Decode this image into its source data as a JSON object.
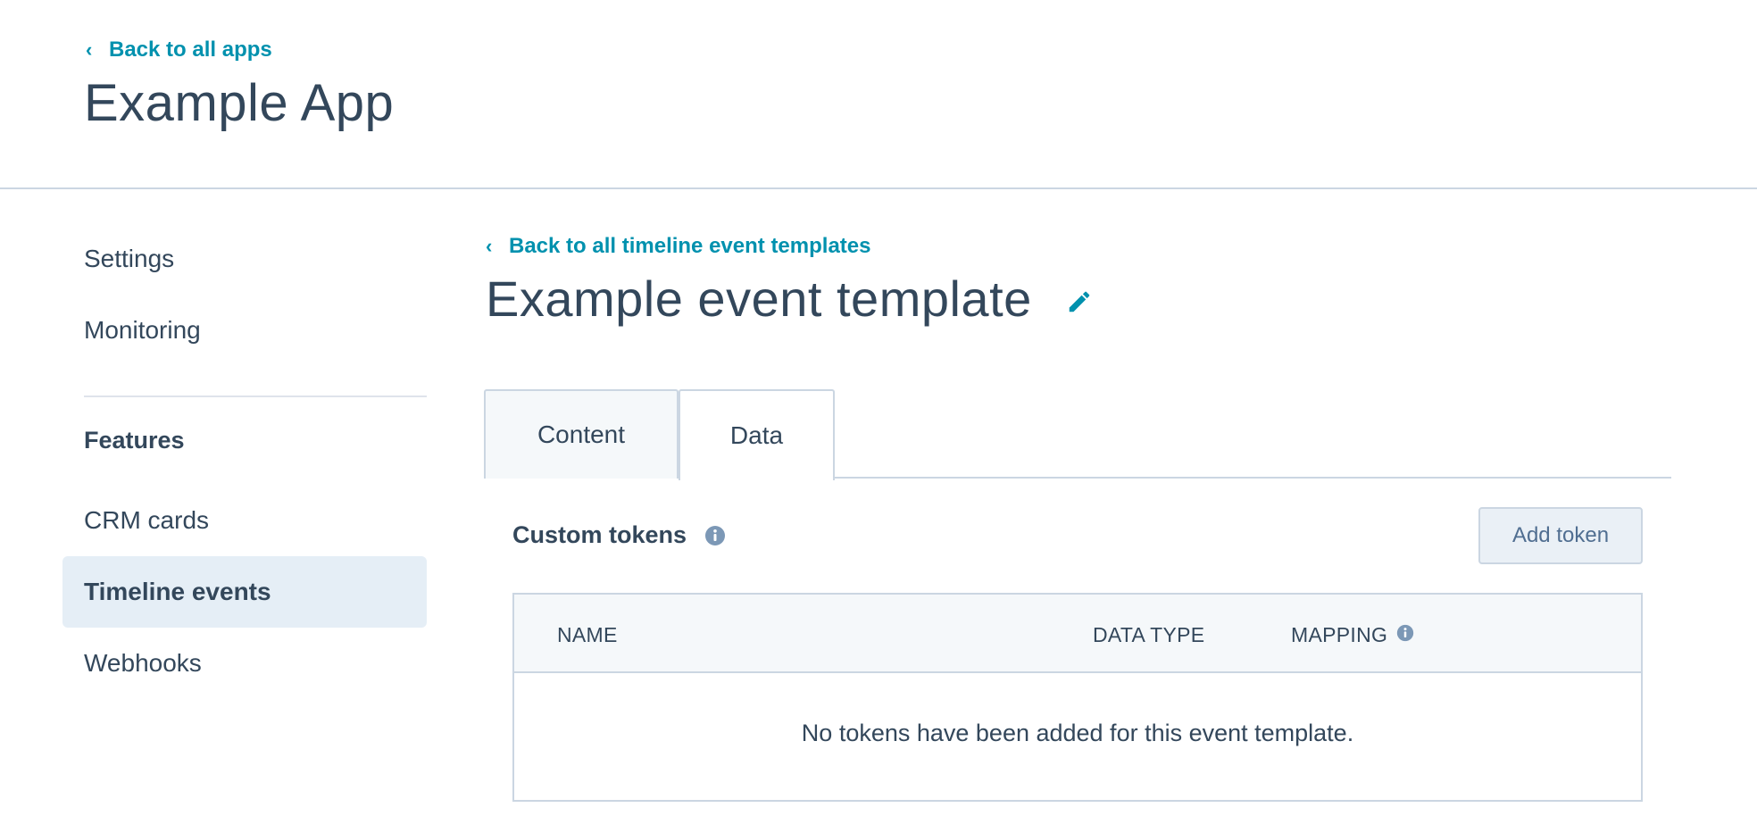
{
  "header": {
    "back_link": "Back to all apps",
    "app_title": "Example App"
  },
  "sidebar": {
    "items": [
      {
        "label": "Settings"
      },
      {
        "label": "Monitoring"
      }
    ],
    "features_heading": "Features",
    "feature_items": [
      {
        "label": "CRM cards"
      },
      {
        "label": "Timeline events",
        "active": true
      },
      {
        "label": "Webhooks"
      }
    ]
  },
  "main": {
    "back_link": "Back to all timeline event templates",
    "title": "Example event template",
    "edit_icon": "pencil-icon",
    "tabs": [
      {
        "label": "Content",
        "active": false
      },
      {
        "label": "Data",
        "active": true
      }
    ],
    "section_title": "Custom tokens",
    "add_button": "Add token",
    "table": {
      "columns": [
        "NAME",
        "DATA TYPE",
        "MAPPING"
      ],
      "empty_message": "No tokens have been added for this event template."
    }
  },
  "colors": {
    "accent": "#0091ae",
    "text": "#33475b",
    "border": "#cbd6e2",
    "active_bg": "#e5eef6",
    "info_icon": "#7c98b6"
  }
}
